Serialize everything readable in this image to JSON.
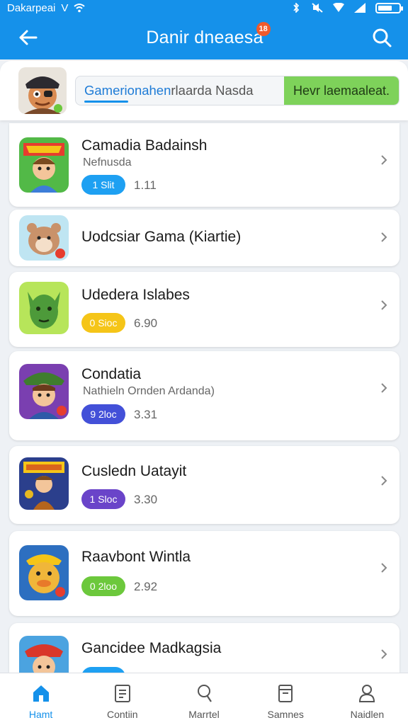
{
  "status_bar": {
    "carrier": "Dakarpeai",
    "network": "V",
    "colors": {
      "background": "#1591ea"
    }
  },
  "header": {
    "title": "Danir dneaesa",
    "badge": "18",
    "back_icon": "arrow-left-icon",
    "search_icon": "search-icon"
  },
  "featured": {
    "highlight_text": "Gamerionahen",
    "text": "rlaarda Nasda",
    "cta_label": "Hevr laemaaleat.",
    "cta_color": "#7ed25a"
  },
  "apps": [
    {
      "title": "Camadia Badainsh",
      "subtitle": "Nefnusda",
      "tag": "1 Slit",
      "tag_color": "#1ea0f2",
      "rating": "1.11"
    },
    {
      "title": "Uodcsiar Gama (Kiartie)",
      "subtitle": "",
      "tag": "",
      "tag_color": "",
      "rating": ""
    },
    {
      "title": "Udedera Islabes",
      "subtitle": "",
      "tag": "0 Sioc",
      "tag_color": "#f5c518",
      "rating": "6.90"
    },
    {
      "title": "Condatia",
      "subtitle": "Nathieln Ornden Ardanda)",
      "tag": "9 2loc",
      "tag_color": "#4350d8",
      "rating": "3.31"
    },
    {
      "title": "Cusledn Uatayit",
      "subtitle": "",
      "tag": "1 Sloc",
      "tag_color": "#6a44c9",
      "rating": "3.30"
    },
    {
      "title": "Raavbont Wintla",
      "subtitle": "",
      "tag": "0 2loo",
      "tag_color": "#6cc83c",
      "rating": "2.92"
    },
    {
      "title": "Gancidee Madkagsia",
      "subtitle": "",
      "tag": "",
      "tag_color": "#1ea0f2",
      "rating": ""
    }
  ],
  "bottom_nav": [
    {
      "label": "Hamt",
      "icon": "home-icon",
      "active": true
    },
    {
      "label": "Contiin",
      "icon": "document-icon",
      "active": false
    },
    {
      "label": "Marrtel",
      "icon": "person-icon",
      "active": false
    },
    {
      "label": "Samnes",
      "icon": "book-icon",
      "active": false
    },
    {
      "label": "Naidlen",
      "icon": "profile-icon",
      "active": false
    }
  ],
  "colors": {
    "primary": "#1591ea",
    "background": "#eef1f5"
  }
}
